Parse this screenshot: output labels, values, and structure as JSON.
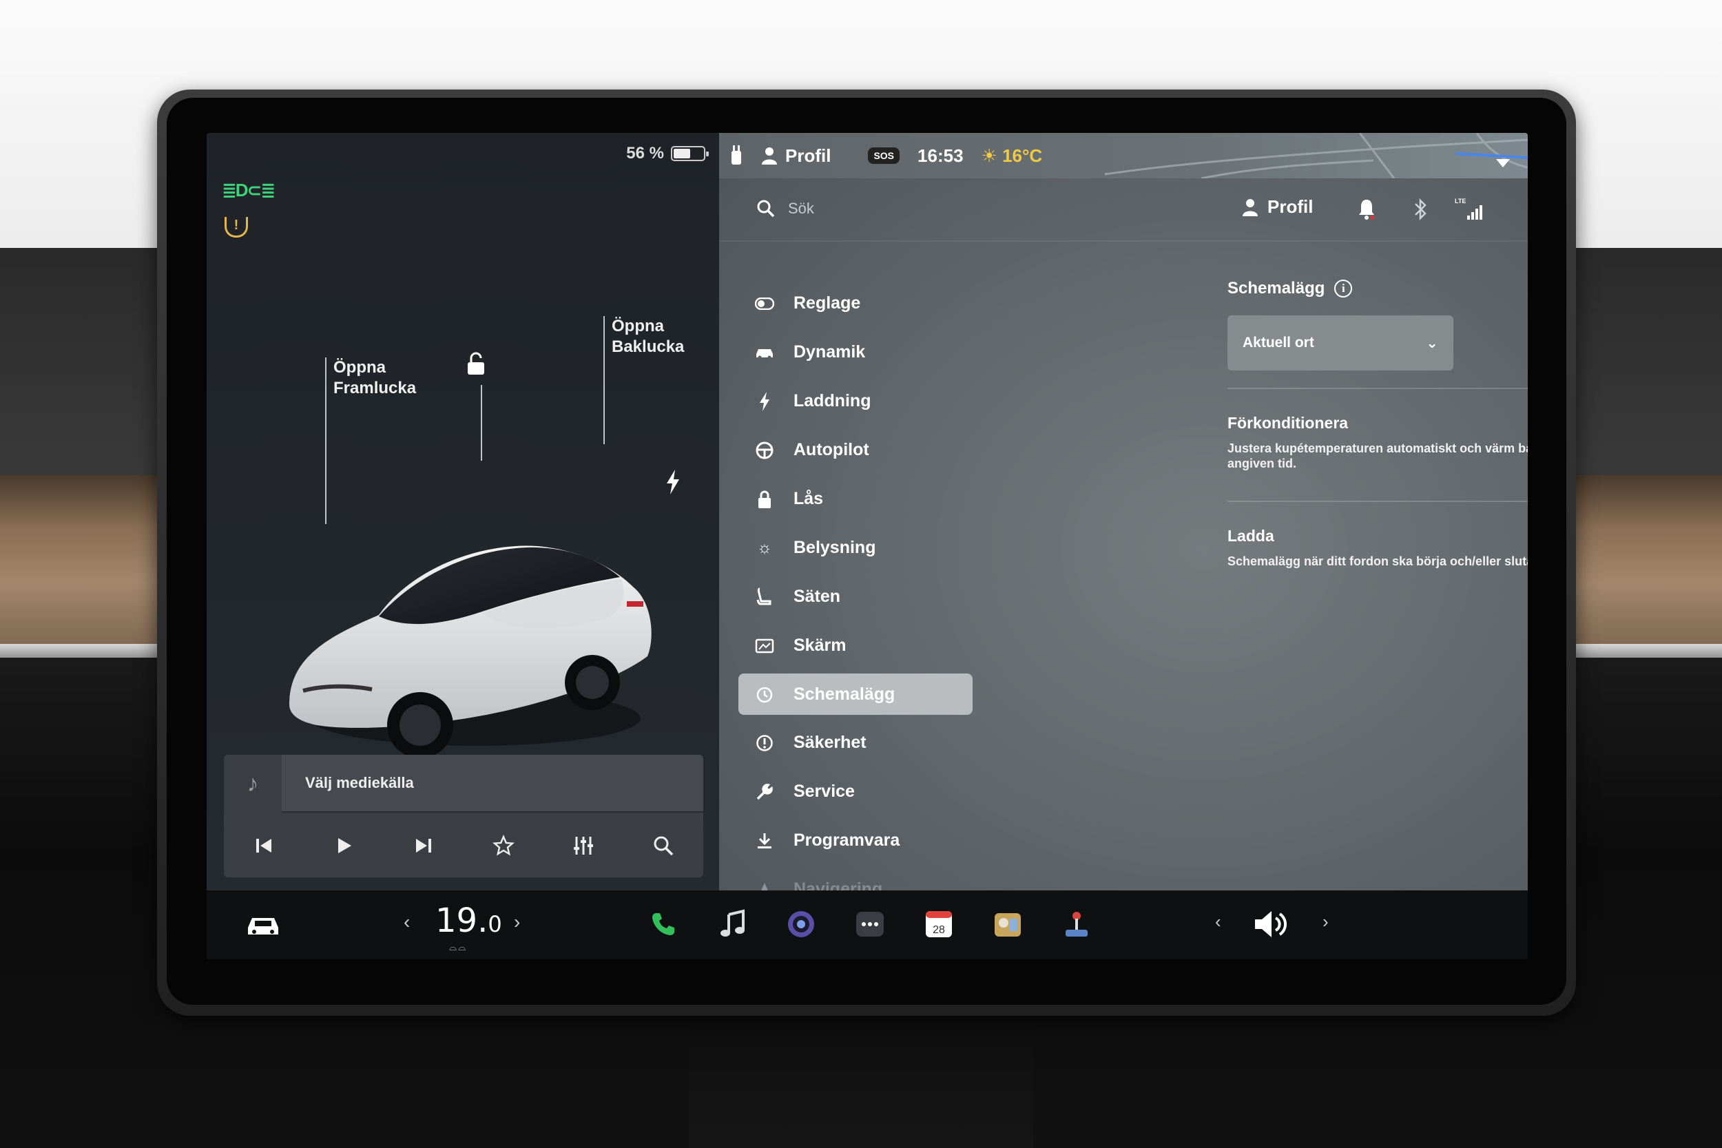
{
  "status": {
    "battery_percent": "56 %",
    "battery_level": 0.56,
    "time": "16:53",
    "temperature": "16°C",
    "profile_label": "Profil",
    "sos_label": "SOS"
  },
  "car_panel": {
    "front_trunk": [
      "Öppna",
      "Framlucka"
    ],
    "rear_trunk": [
      "Öppna",
      "Baklucka"
    ],
    "icons": [
      "headlights-icon",
      "tire-pressure-warning-icon",
      "unlock-icon",
      "charge-port-icon"
    ],
    "colors": {
      "lights_on": "#3ed37a",
      "warning": "#e5b74a"
    }
  },
  "media": {
    "title": "Välj mediekälla",
    "controls": [
      "previous-icon",
      "play-icon",
      "next-icon",
      "favorite-icon",
      "equalizer-icon",
      "search-icon"
    ]
  },
  "topbar": {
    "search_placeholder": "Sök",
    "profile_label": "Profil",
    "signal_label": "LTE"
  },
  "nav": {
    "items": [
      {
        "label": "Reglage",
        "icon": "toggle-icon"
      },
      {
        "label": "Dynamik",
        "icon": "car-icon"
      },
      {
        "label": "Laddning",
        "icon": "bolt-icon"
      },
      {
        "label": "Autopilot",
        "icon": "steering-wheel-icon"
      },
      {
        "label": "Lås",
        "icon": "lock-icon"
      },
      {
        "label": "Belysning",
        "icon": "sun-icon"
      },
      {
        "label": "Säten",
        "icon": "seat-icon"
      },
      {
        "label": "Skärm",
        "icon": "display-icon"
      },
      {
        "label": "Schemalägg",
        "icon": "clock-icon",
        "active": true
      },
      {
        "label": "Säkerhet",
        "icon": "alert-icon"
      },
      {
        "label": "Service",
        "icon": "wrench-icon"
      },
      {
        "label": "Programvara",
        "icon": "download-icon"
      },
      {
        "label": "Navigering",
        "icon": "navigation-icon"
      }
    ]
  },
  "schedule": {
    "title": "Schemalägg",
    "location_value": "Aktuell ort",
    "precondition": {
      "title": "Förkonditionera",
      "description": "Justera kupétemperaturen automatiskt och värm batteriet till en angiven tid."
    },
    "charge": {
      "title": "Ladda",
      "description": "Schemalägg när ditt fordon ska börja och/eller sluta laddas."
    }
  },
  "dock": {
    "cabin_temp_whole": "19.",
    "cabin_temp_decimal": "0",
    "calendar_day": "28",
    "apps": [
      "phone-icon",
      "music-icon",
      "camera-icon",
      "more-apps-icon",
      "calendar-icon",
      "toybox-icon",
      "arcade-joystick-icon"
    ],
    "accent_phone": "#32c05a"
  }
}
